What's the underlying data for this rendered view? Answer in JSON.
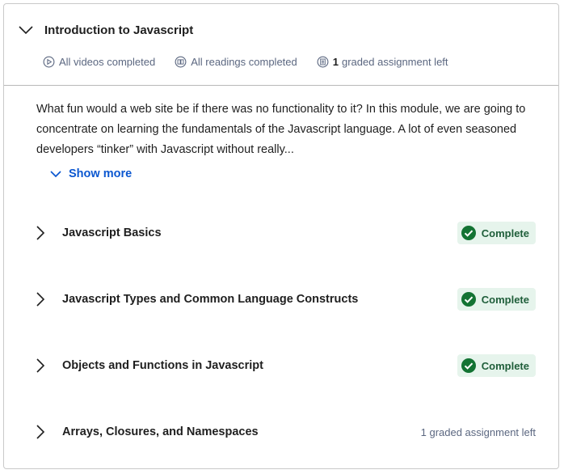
{
  "module": {
    "title": "Introduction to Javascript",
    "meta": {
      "videos": "All videos completed",
      "readings": "All readings completed",
      "graded_count": "1",
      "graded_text": "graded assignment left"
    },
    "description": "What fun would a web site be if there was no functionality to it? In this module, we are going to concentrate on learning the fundamentals of the Javascript language. A lot of even seasoned developers “tinker” with Javascript without really...",
    "show_more_label": "Show more"
  },
  "lessons": [
    {
      "title": "Javascript Basics",
      "status": "Complete"
    },
    {
      "title": "Javascript Types and Common Language Constructs",
      "status": "Complete"
    },
    {
      "title": "Objects and Functions in Javascript",
      "status": "Complete"
    },
    {
      "title": "Arrays, Closures, and Namespaces",
      "status": "1 graded assignment left"
    }
  ],
  "colors": {
    "link": "#0b57d0",
    "complete_bg": "#e6f4ec",
    "complete_icon": "#137333",
    "muted_text": "#5b6780"
  }
}
